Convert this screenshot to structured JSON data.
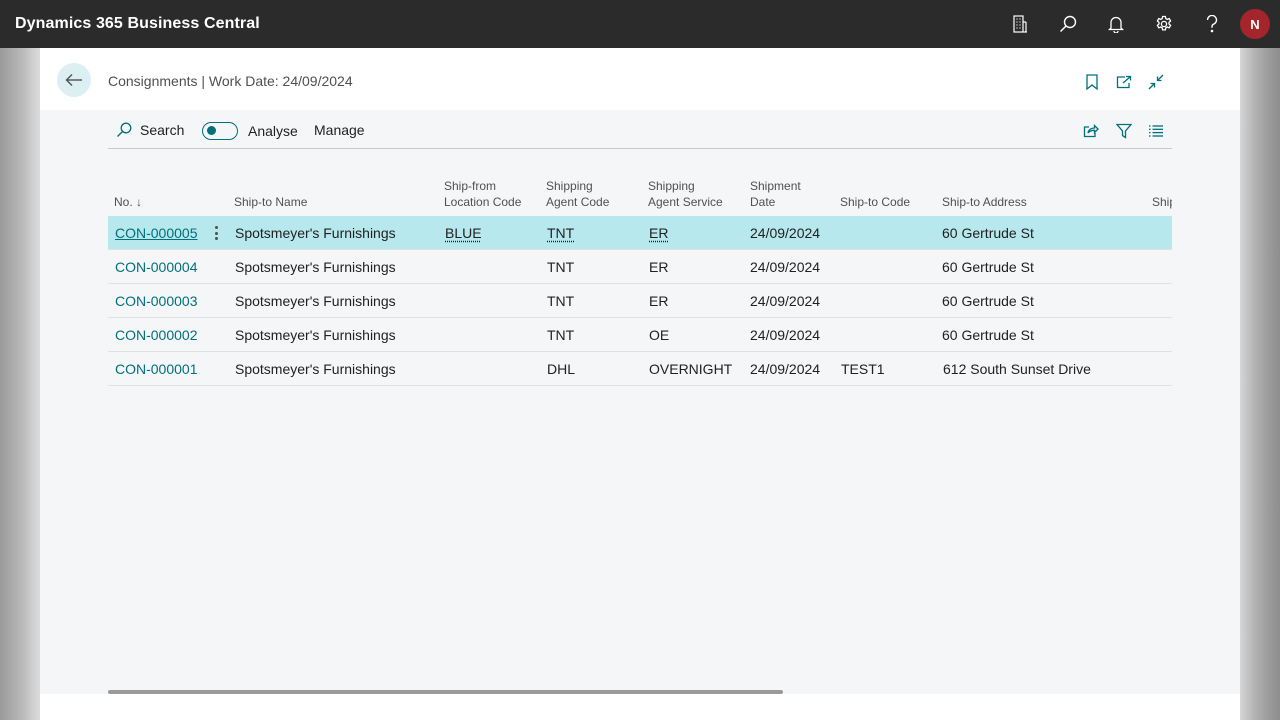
{
  "app": {
    "title": "Dynamics 365 Business Central",
    "user_initial": "N"
  },
  "topbar": {
    "icons": [
      "company-icon",
      "search-icon",
      "bell-icon",
      "gear-icon",
      "help-icon"
    ]
  },
  "page": {
    "title": "Consignments | Work Date: 24/09/2024"
  },
  "actions": {
    "search_label": "Search",
    "analyse_label": "Analyse",
    "manage_label": "Manage",
    "analyse_on": false
  },
  "colors": {
    "accent": "#00707a",
    "selected_row": "#b6e8ed",
    "topbar": "#2b2b2b",
    "avatar": "#a4262c"
  },
  "columns": {
    "no": "No. ↓",
    "ship_to_name": "Ship-to Name",
    "ship_from_loc_1": "Ship-from",
    "ship_from_loc_2": "Location Code",
    "agent_code_1": "Shipping",
    "agent_code_2": "Agent Code",
    "agent_service_1": "Shipping",
    "agent_service_2": "Agent Service",
    "shipment_date_1": "Shipment",
    "shipment_date_2": "Date",
    "ship_to_code": "Ship-to Code",
    "ship_to_address": "Ship-to Address",
    "truncated": "Ship"
  },
  "rows": [
    {
      "no": "CON-000005",
      "ship_to_name": "Spotsmeyer's Furnishings",
      "location": "BLUE",
      "agent": "TNT",
      "service": "ER",
      "date": "24/09/2024",
      "ship_to_code": "",
      "address": "60 Gertrude St"
    },
    {
      "no": "CON-000004",
      "ship_to_name": "Spotsmeyer's Furnishings",
      "location": "",
      "agent": "TNT",
      "service": "ER",
      "date": "24/09/2024",
      "ship_to_code": "",
      "address": "60 Gertrude St"
    },
    {
      "no": "CON-000003",
      "ship_to_name": "Spotsmeyer's Furnishings",
      "location": "",
      "agent": "TNT",
      "service": "ER",
      "date": "24/09/2024",
      "ship_to_code": "",
      "address": "60 Gertrude St"
    },
    {
      "no": "CON-000002",
      "ship_to_name": "Spotsmeyer's Furnishings",
      "location": "",
      "agent": "TNT",
      "service": "OE",
      "date": "24/09/2024",
      "ship_to_code": "",
      "address": "60 Gertrude St"
    },
    {
      "no": "CON-000001",
      "ship_to_name": "Spotsmeyer's Furnishings",
      "location": "",
      "agent": "DHL",
      "service": "OVERNIGHT",
      "date": "24/09/2024",
      "ship_to_code": "TEST1",
      "address": "612 South Sunset Drive"
    }
  ]
}
